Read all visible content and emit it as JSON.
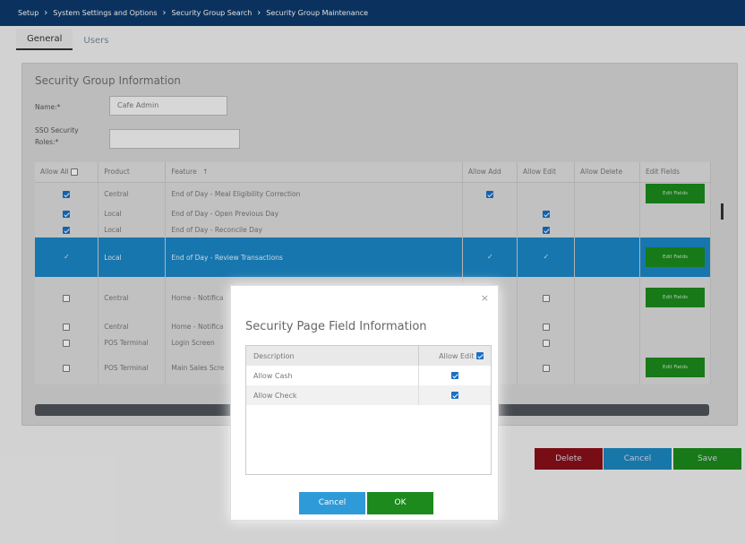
{
  "breadcrumb": [
    "Setup",
    "System Settings and Options",
    "Security Group Search",
    "Security Group Maintenance"
  ],
  "tabs": [
    {
      "label": "General",
      "active": true
    },
    {
      "label": "Users",
      "active": false
    }
  ],
  "section_title": "Security Group Information",
  "form": {
    "name_label": "Name:*",
    "name_value": "Cafe Admin",
    "sso_label_line1": "SSO Security",
    "sso_label_line2": "Roles:*",
    "sso_value": ""
  },
  "grid": {
    "headers": {
      "allow_all": "Allow All",
      "product": "Product",
      "feature": "Feature",
      "sort": "↑",
      "allow_add": "Allow Add",
      "allow_edit": "Allow Edit",
      "allow_delete": "Allow Delete",
      "edit_fields": "Edit Fields"
    },
    "edit_fields_label": "Edit Fields",
    "rows": [
      {
        "product": "Central",
        "feature": "End of Day - Meal Eligibility Correction"
      },
      {
        "product": "Local",
        "feature": "End of Day - Open Previous Day"
      },
      {
        "product": "Local",
        "feature": "End of Day - Reconcile Day"
      },
      {
        "product": "Local",
        "feature": "End of Day - Review Transactions"
      },
      {
        "product": "Central",
        "feature": "Home - Notifica"
      },
      {
        "product": "Central",
        "feature": "Home - Notifica"
      },
      {
        "product": "POS Terminal",
        "feature": "Login Screen"
      },
      {
        "product": "POS Terminal",
        "feature": "Main Sales Scre"
      }
    ]
  },
  "footer": {
    "delete": "Delete",
    "cancel": "Cancel",
    "save": "Save"
  },
  "modal": {
    "close": "×",
    "title": "Security Page Field Information",
    "col_description": "Description",
    "col_allow_edit": "Allow Edit",
    "rows": [
      {
        "description": "Allow Cash"
      },
      {
        "description": "Allow Check"
      }
    ],
    "cancel": "Cancel",
    "ok": "OK"
  },
  "colors": {
    "topbar": "#0d3a6b",
    "selected_row": "#1b87c6",
    "green": "#1c8a1c",
    "delete": "#8a0f18",
    "cancel": "#1b88c0",
    "modal_cancel": "#2f9ad8"
  }
}
